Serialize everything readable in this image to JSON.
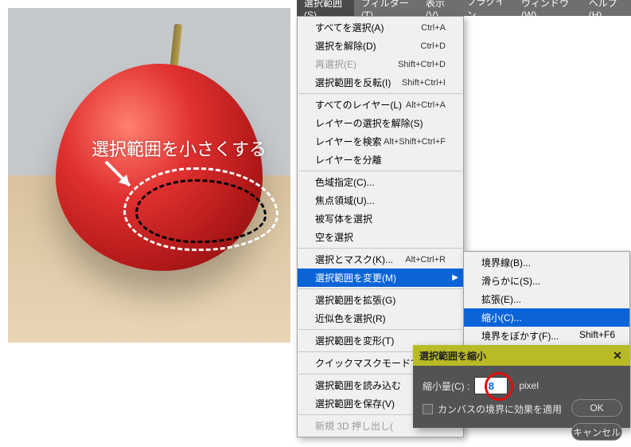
{
  "menubar": {
    "items": [
      {
        "label": "選択範囲(S)"
      },
      {
        "label": "フィルター(T)"
      },
      {
        "label": "表示(V)"
      },
      {
        "label": "プラグイン"
      },
      {
        "label": "ウィンドウ(W)"
      },
      {
        "label": "ヘルプ(H)"
      }
    ]
  },
  "annotation": {
    "text": "選択範囲を小さくする"
  },
  "menu": {
    "g1": [
      {
        "label": "すべてを選択(A)",
        "shortcut": "Ctrl+A"
      },
      {
        "label": "選択を解除(D)",
        "shortcut": "Ctrl+D"
      },
      {
        "label": "再選択(E)",
        "shortcut": "Shift+Ctrl+D",
        "disabled": true
      },
      {
        "label": "選択範囲を反転(I)",
        "shortcut": "Shift+Ctrl+I"
      }
    ],
    "g2": [
      {
        "label": "すべてのレイヤー(L)",
        "shortcut": "Alt+Ctrl+A"
      },
      {
        "label": "レイヤーの選択を解除(S)",
        "shortcut": ""
      },
      {
        "label": "レイヤーを検索",
        "shortcut": "Alt+Shift+Ctrl+F"
      },
      {
        "label": "レイヤーを分離",
        "shortcut": ""
      }
    ],
    "g3": [
      {
        "label": "色域指定(C)...",
        "shortcut": ""
      },
      {
        "label": "焦点領域(U)...",
        "shortcut": ""
      },
      {
        "label": "被写体を選択",
        "shortcut": ""
      },
      {
        "label": "空を選択",
        "shortcut": ""
      }
    ],
    "g4": [
      {
        "label": "選択とマスク(K)...",
        "shortcut": "Alt+Ctrl+R"
      },
      {
        "label": "選択範囲を変更(M)",
        "shortcut": "",
        "hl": true,
        "sub": true
      }
    ],
    "g5": [
      {
        "label": "選択範囲を拡張(G)",
        "shortcut": ""
      },
      {
        "label": "近似色を選択(R)",
        "shortcut": ""
      }
    ],
    "g6": [
      {
        "label": "選択範囲を変形(T)",
        "shortcut": ""
      }
    ],
    "g7": [
      {
        "label": "クイックマスクモードで",
        "shortcut": ""
      }
    ],
    "g8": [
      {
        "label": "選択範囲を読み込む",
        "shortcut": ""
      },
      {
        "label": "選択範囲を保存(V)",
        "shortcut": ""
      }
    ],
    "g9": [
      {
        "label": "新規 3D 押し出し(",
        "shortcut": "",
        "disabled": true
      }
    ]
  },
  "submenu": {
    "items": [
      {
        "label": "境界線(B)...",
        "shortcut": ""
      },
      {
        "label": "滑らかに(S)...",
        "shortcut": ""
      },
      {
        "label": "拡張(E)...",
        "shortcut": ""
      },
      {
        "label": "縮小(C)...",
        "shortcut": "",
        "hl": true
      },
      {
        "label": "境界をぼかす(F)...",
        "shortcut": "Shift+F6"
      }
    ]
  },
  "dialog": {
    "title": "選択範囲を縮小",
    "amount_label": "縮小量(C) :",
    "amount_value": "8",
    "unit": "pixel",
    "checkbox_label": "カンバスの境界に効果を適用",
    "ok": "OK",
    "cancel": "キャンセル"
  }
}
